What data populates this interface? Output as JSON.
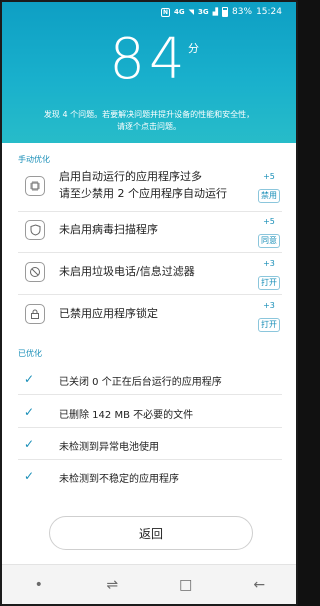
{
  "status_bar": {
    "nfc": "N",
    "signal_1": "4G",
    "signal_2": "3G",
    "battery": "83%",
    "time": "15:24"
  },
  "hero": {
    "score": "84",
    "unit": "分",
    "message": "发现 4 个问题。若要解决问题并提升设备的性能和安全性，请逐个点击问题。"
  },
  "manual": {
    "label": "手动优化",
    "items": [
      {
        "text_line1": "启用自动运行的应用程序过多",
        "text_line2": "请至少禁用 2 个应用程序自动运行",
        "plus": "+5",
        "action": "禁用",
        "icon": "chip-icon"
      },
      {
        "text_line1": "未启用病毒扫描程序",
        "plus": "+5",
        "action": "同意",
        "icon": "shield-icon"
      },
      {
        "text_line1": "未启用垃圾电话/信息过滤器",
        "plus": "+3",
        "action": "打开",
        "icon": "block-icon"
      },
      {
        "text_line1": "已禁用应用程序锁定",
        "plus": "+3",
        "action": "打开",
        "icon": "lock-icon"
      }
    ]
  },
  "optimized": {
    "label": "已优化",
    "items": [
      {
        "text": "已关闭 0 个正在后台运行的应用程序"
      },
      {
        "text": "已删除 142 MB 不必要的文件"
      },
      {
        "text": "未检测到异常电池使用"
      },
      {
        "text": "未检测到不稳定的应用程序"
      }
    ]
  },
  "back_button": "返回",
  "nav": {
    "dot": "•",
    "recent": "⇌",
    "home": "□",
    "back": "←"
  }
}
